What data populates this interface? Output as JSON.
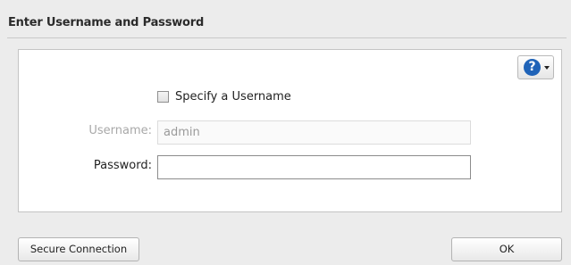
{
  "dialog": {
    "title": "Enter Username and Password"
  },
  "help": {
    "icon": "help-circle-icon",
    "glyph": "?",
    "accent": "#1f63b8"
  },
  "form": {
    "specify_username_label": "Specify a Username",
    "specify_username_checked": false,
    "username_label": "Username:",
    "username_value": "admin",
    "username_disabled": true,
    "password_label": "Password:",
    "password_value": ""
  },
  "buttons": {
    "secure_connection": "Secure Connection",
    "ok": "OK"
  }
}
